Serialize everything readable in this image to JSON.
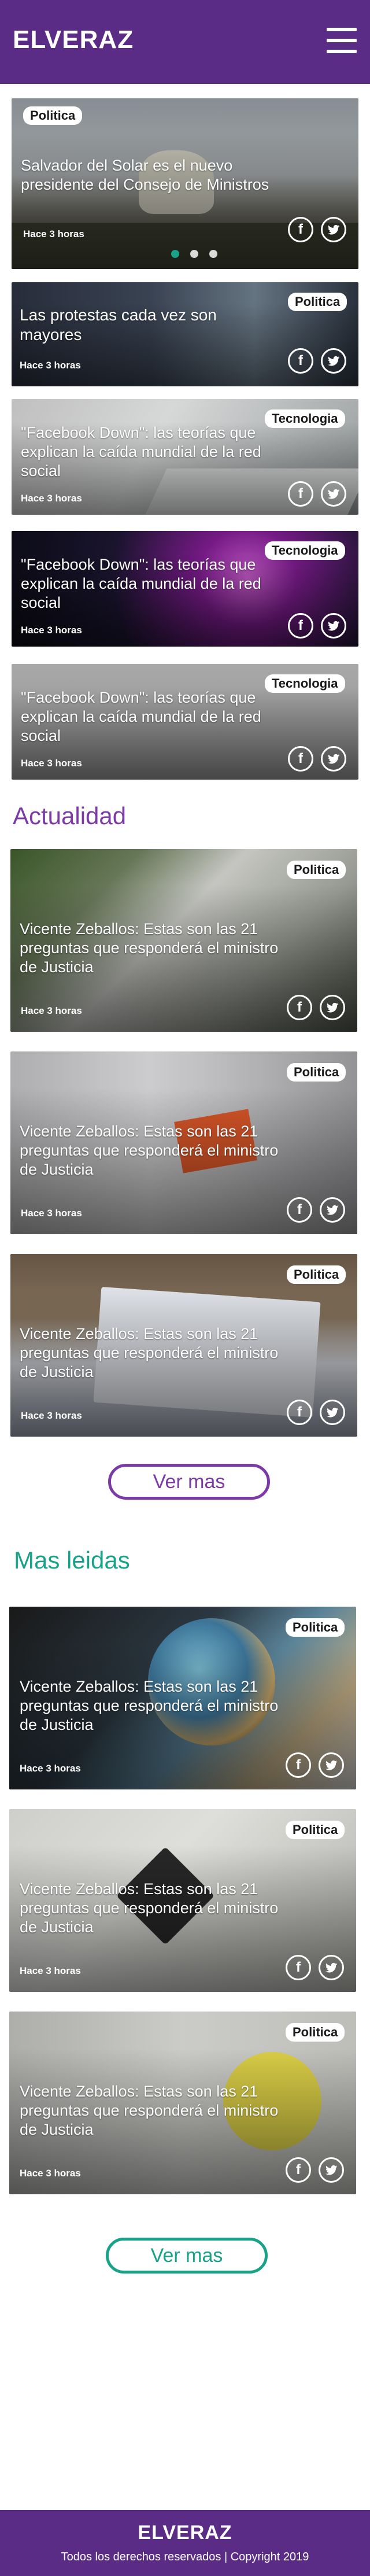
{
  "header": {
    "logo": "ELVERAZ"
  },
  "hero": {
    "badge": "Politica",
    "title": "Salvador del Solar es el nuevo presidente del Consejo de Ministros",
    "time": "Hace 3 horas"
  },
  "top_cards": [
    {
      "badge": "Politica",
      "title": "Las protestas cada vez son mayores",
      "time": "Hace 3 horas"
    },
    {
      "badge": "Tecnologia",
      "title": "\"Facebook Down\": las teorías que explican la caída mundial de la red social",
      "time": "Hace 3 horas"
    },
    {
      "badge": "Tecnologia",
      "title": "\"Facebook Down\": las teorías que explican la caída mundial de la red social",
      "time": "Hace 3 horas"
    },
    {
      "badge": "Tecnologia",
      "title": "\"Facebook Down\": las teorías que explican la caída mundial de la red social",
      "time": "Hace 3 horas"
    }
  ],
  "actualidad": {
    "title": "Actualidad",
    "cards": [
      {
        "badge": "Politica",
        "title": "Vicente Zeballos: Estas son las 21 preguntas que responderá el ministro de Justicia",
        "time": "Hace 3 horas"
      },
      {
        "badge": "Politica",
        "title": "Vicente Zeballos: Estas son las 21 preguntas que responderá el ministro de Justicia",
        "time": "Hace 3 horas"
      },
      {
        "badge": "Politica",
        "title": "Vicente Zeballos: Estas son las 21 preguntas que responderá el ministro de Justicia",
        "time": "Hace 3 horas"
      }
    ],
    "more": "Ver mas"
  },
  "mas_leidas": {
    "title": "Mas leidas",
    "cards": [
      {
        "badge": "Politica",
        "title": "Vicente Zeballos: Estas son las 21 preguntas que responderá el ministro de Justicia",
        "time": "Hace 3 horas"
      },
      {
        "badge": "Politica",
        "title": "Vicente Zeballos: Estas son las 21 preguntas que responderá el ministro de Justicia",
        "time": "Hace 3 horas"
      },
      {
        "badge": "Politica",
        "title": "Vicente Zeballos: Estas son las 21 preguntas que responderá el ministro de Justicia",
        "time": "Hace 3 horas"
      }
    ],
    "more": "Ver mas"
  },
  "social": {
    "facebook": "f",
    "twitter": "twitter-icon"
  },
  "footer": {
    "logo": "ELVERAZ",
    "copyright": "Todos los derechos reservados  | Copyright 2019"
  },
  "colors": {
    "brand_purple": "#5b2c86",
    "section_purple": "#7b3aa6",
    "accent_green": "#18a389"
  }
}
